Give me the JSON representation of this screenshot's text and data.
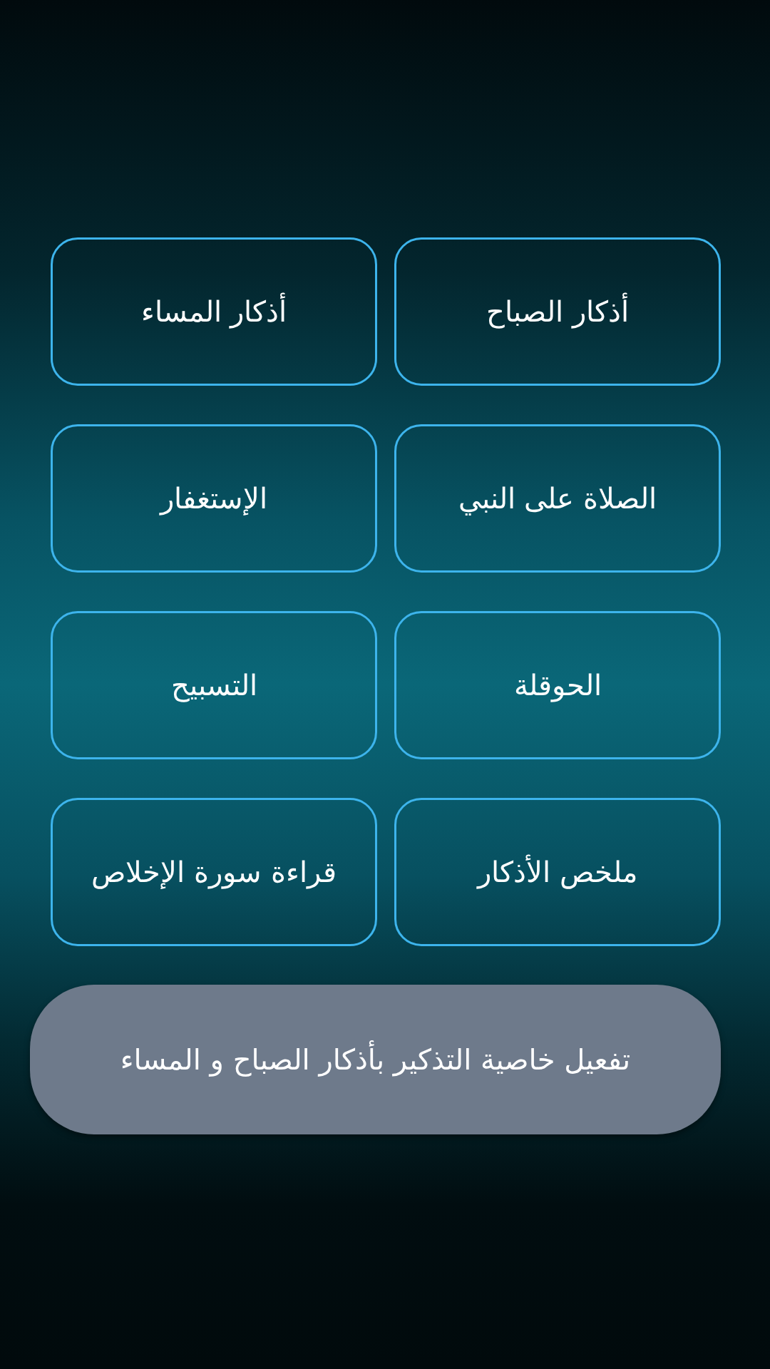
{
  "menu_buttons": [
    {
      "label": "أذكار الصباح"
    },
    {
      "label": "أذكار المساء"
    },
    {
      "label": "الصلاة على النبي"
    },
    {
      "label": "الإستغفار"
    },
    {
      "label": "الحوقلة"
    },
    {
      "label": "التسبيح"
    },
    {
      "label": "ملخص الأذكار"
    },
    {
      "label": "قراءة سورة الإخلاص"
    }
  ],
  "reminder_button": {
    "label": "تفعيل خاصية التذكير بأذكار الصباح و المساء"
  }
}
